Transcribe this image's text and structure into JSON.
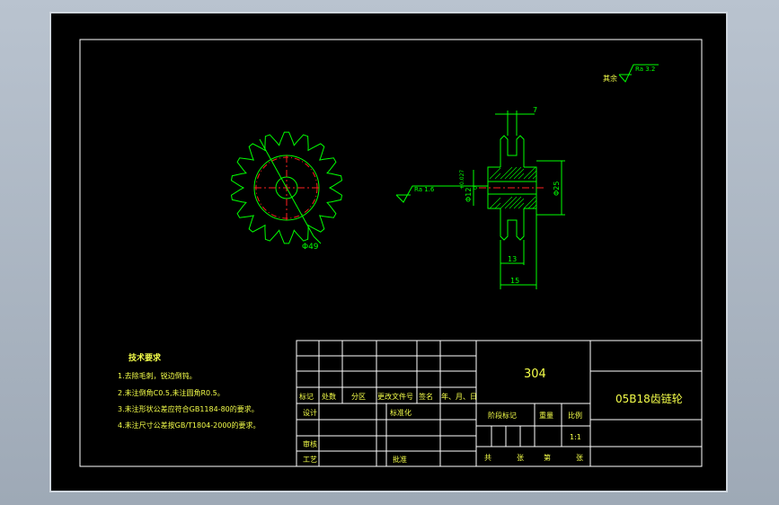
{
  "colors": {
    "background": "#a8b3bf",
    "sheet": "#000000",
    "frame": "#ffffff",
    "outline": "#00ff00",
    "centerline": "#ff2020",
    "text": "#f5ff4a"
  },
  "drawing": {
    "roughness_other": "其余",
    "roughness_other_value": "Ra 3.2",
    "roughness_bore": "Ra 1.6",
    "dim_width_top": "7",
    "dim_hub_dia": "Φ25",
    "dim_bore": "Φ12",
    "dim_bore_tol_upper": "+0.027",
    "dim_bore_tol_lower": "0",
    "dim_hub_len": "13",
    "dim_total_len": "15",
    "dim_outer_dia": "Φ49"
  },
  "tech": {
    "title": "技术要求",
    "items": [
      "1.去除毛刺，锐边倒钝。",
      "2.未注倒角C0.5,未注圆角R0.5。",
      "3.未注形状公差应符合GB1184-80的要求。",
      "4.未注尺寸公差按GB/T1804-2000的要求。"
    ]
  },
  "title_block": {
    "material": "304",
    "part_name": "05B18齿链轮",
    "headers": [
      "标记",
      "处数",
      "分区",
      "更改文件号",
      "签名",
      "年、月、日"
    ],
    "design": "设计",
    "standardize": "标准化",
    "stage_mark": "阶段标记",
    "weight": "重量",
    "scale": "比例",
    "scale_value": "1:1",
    "review": "审核",
    "process": "工艺",
    "approve": "批准",
    "total": "共",
    "sheet_unit": "张",
    "page_no": "第",
    "page_unit": "张"
  }
}
